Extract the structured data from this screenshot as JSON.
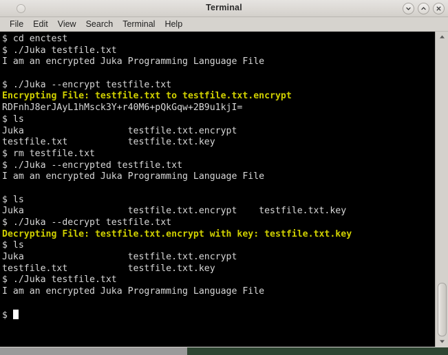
{
  "window": {
    "title": "Terminal",
    "controls": [
      {
        "name": "minimize",
        "glyph": "chevron-down"
      },
      {
        "name": "maximize",
        "glyph": "chevron-up"
      },
      {
        "name": "close",
        "glyph": "x"
      }
    ]
  },
  "menubar": {
    "items": [
      {
        "label": "File"
      },
      {
        "label": "Edit"
      },
      {
        "label": "View"
      },
      {
        "label": "Search"
      },
      {
        "label": "Terminal"
      },
      {
        "label": "Help"
      }
    ]
  },
  "terminal": {
    "colors": {
      "background": "#000000",
      "foreground": "#d8d8d8",
      "highlight": "#d0d000",
      "cursor": "#ffffff"
    },
    "prompt": "$",
    "cursor_visible": true,
    "lines": [
      {
        "text": "$ cd enctest",
        "style": "normal"
      },
      {
        "text": "$ ./Juka testfile.txt",
        "style": "normal"
      },
      {
        "text": "I am an encrypted Juka Programming Language File",
        "style": "normal"
      },
      {
        "text": "",
        "style": "normal"
      },
      {
        "text": "$ ./Juka --encrypt testfile.txt",
        "style": "normal"
      },
      {
        "text": "Encrypting File: testfile.txt to testfile.txt.encrypt",
        "style": "highlight"
      },
      {
        "text": "RDFnhJ8erJAyL1hMsck3Y+r40M6+pQkGqw+2B9u1kjI=",
        "style": "normal"
      },
      {
        "text": "$ ls",
        "style": "normal"
      },
      {
        "text": "Juka                   testfile.txt.encrypt",
        "style": "normal"
      },
      {
        "text": "testfile.txt           testfile.txt.key",
        "style": "normal"
      },
      {
        "text": "$ rm testfile.txt",
        "style": "normal"
      },
      {
        "text": "$ ./Juka --encrypted testfile.txt",
        "style": "normal"
      },
      {
        "text": "I am an encrypted Juka Programming Language File",
        "style": "normal"
      },
      {
        "text": "",
        "style": "normal"
      },
      {
        "text": "$ ls",
        "style": "normal"
      },
      {
        "text": "Juka                   testfile.txt.encrypt    testfile.txt.key",
        "style": "normal"
      },
      {
        "text": "$ ./Juka --decrypt testfile.txt",
        "style": "normal"
      },
      {
        "text": "Decrypting File: testfile.txt.encrypt with key: testfile.txt.key",
        "style": "highlight"
      },
      {
        "text": "$ ls",
        "style": "normal"
      },
      {
        "text": "Juka                   testfile.txt.encrypt",
        "style": "normal"
      },
      {
        "text": "testfile.txt           testfile.txt.key",
        "style": "normal"
      },
      {
        "text": "$ ./Juka testfile.txt",
        "style": "normal"
      },
      {
        "text": "I am an encrypted Juka Programming Language File",
        "style": "normal"
      },
      {
        "text": "",
        "style": "normal"
      },
      {
        "text": "$ ",
        "style": "cursor"
      }
    ]
  },
  "scrollbar": {
    "up_arrow": "scroll-up",
    "down_arrow": "scroll-down",
    "thumb_position_percent": 82
  }
}
